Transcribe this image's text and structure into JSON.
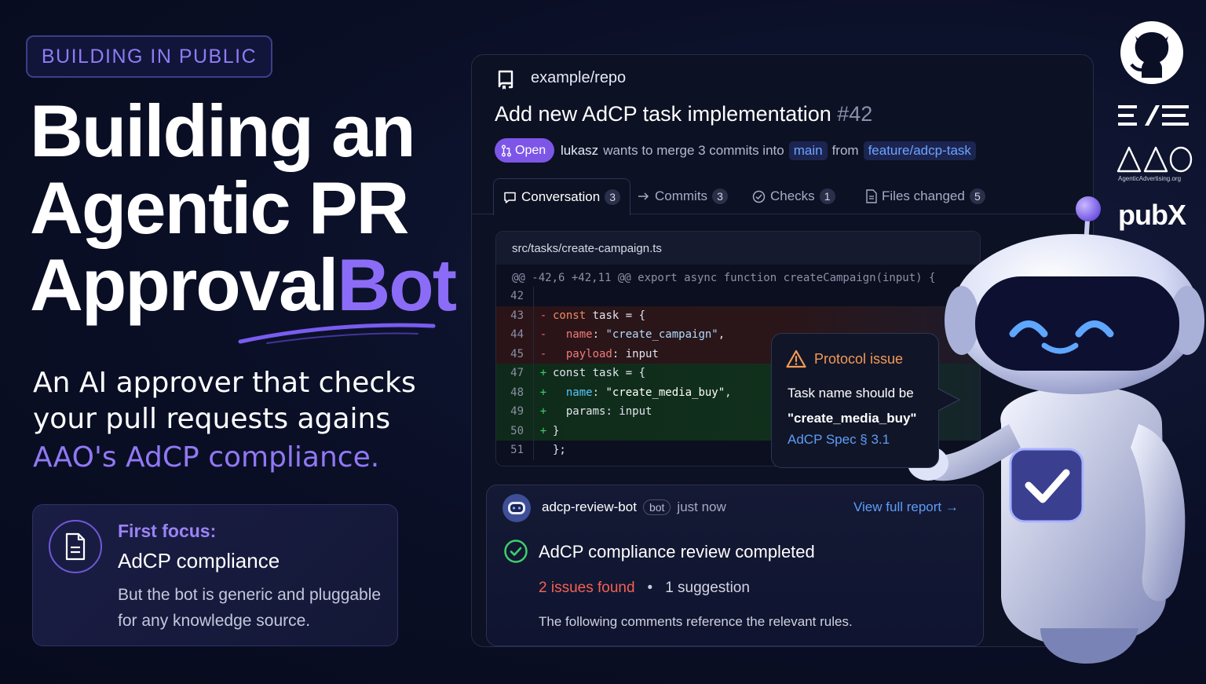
{
  "badge": "BUILDING IN PUBLIC",
  "headline": {
    "line1": "Building an",
    "line2": "Agentic PR",
    "line3a": "Approval",
    "line3b": "Bot"
  },
  "subtitle": {
    "line1": "An AI approver that checks",
    "line2": "your pull requests agains",
    "accent": "AAO's AdCP compliance."
  },
  "focus": {
    "kicker": "First focus:",
    "title": "AdCP compliance",
    "description": "But the bot is generic and pluggable for any knowledge source.",
    "icon": "document-icon"
  },
  "pr": {
    "repo": "example/repo",
    "title": "Add new AdCP task implementation",
    "number": "#42",
    "status": "Open",
    "author": "lukasz",
    "merge_text": "wants to merge 3 commits into",
    "base_branch": "main",
    "from_text": "from",
    "head_branch": "feature/adcp-task",
    "tabs": [
      {
        "label": "Conversation",
        "count": "3",
        "icon": "comment-icon"
      },
      {
        "label": "Commits",
        "count": "3",
        "icon": "commit-arrow-icon"
      },
      {
        "label": "Checks",
        "count": "1",
        "icon": "check-circle-icon"
      },
      {
        "label": "Files changed",
        "count": "5",
        "icon": "file-icon"
      }
    ]
  },
  "diff": {
    "file": "src/tasks/create-campaign.ts",
    "hunk": "@@ -42,6 +42,11 @@ export async function createCampaign(input) {",
    "lines": [
      {
        "ln": "42",
        "sign": "",
        "type": "ctx"
      },
      {
        "ln": "43",
        "sign": "-",
        "type": "del"
      },
      {
        "ln": "44",
        "sign": "-",
        "type": "del"
      },
      {
        "ln": "45",
        "sign": "-",
        "type": "del"
      },
      {
        "ln": "47",
        "sign": "+",
        "type": "add"
      },
      {
        "ln": "48",
        "sign": "+",
        "type": "add"
      },
      {
        "ln": "49",
        "sign": "+",
        "type": "add"
      },
      {
        "ln": "50",
        "sign": "+",
        "type": "add"
      },
      {
        "ln": "51",
        "sign": "",
        "type": "ctx"
      }
    ],
    "code": {
      "l43_kw": "const",
      "l43_rest": " task = {",
      "l44_key": "name",
      "l44_colon": ": ",
      "l44_str": "\"create_campaign\"",
      "l44_end": ",",
      "l45_key": "payload",
      "l45_rest": ": input",
      "l47_kw": "const",
      "l47_rest": " task = {",
      "l48_key": "name",
      "l48_colon": ": ",
      "l48_str": "\"create_media_buy\"",
      "l48_end": ",",
      "l49_key": "params",
      "l49_rest": ": input",
      "l50": "}",
      "l51": "};"
    }
  },
  "callout": {
    "title": "Protocol issue",
    "text": "Task name should be",
    "quote": "\"create_media_buy\"",
    "link": "AdCP Spec § 3.1"
  },
  "review": {
    "bot": "adcp-review-bot",
    "bot_badge": "bot",
    "time": "just now",
    "view_link": "View full report →",
    "title": "AdCP compliance review completed",
    "issues": "2 issues found",
    "separator": "•",
    "suggestions": "1 suggestion",
    "note": "The following comments reference the relevant rules."
  },
  "logos": {
    "aao_caption": "AgenticAdvertising.org",
    "pubx": "pubX"
  },
  "colors": {
    "accent": "#8b6cf6",
    "open": "#7d56e8",
    "link": "#5e9df7",
    "issue": "#f46152",
    "warning": "#f39a55",
    "success": "#3fcf6d"
  }
}
